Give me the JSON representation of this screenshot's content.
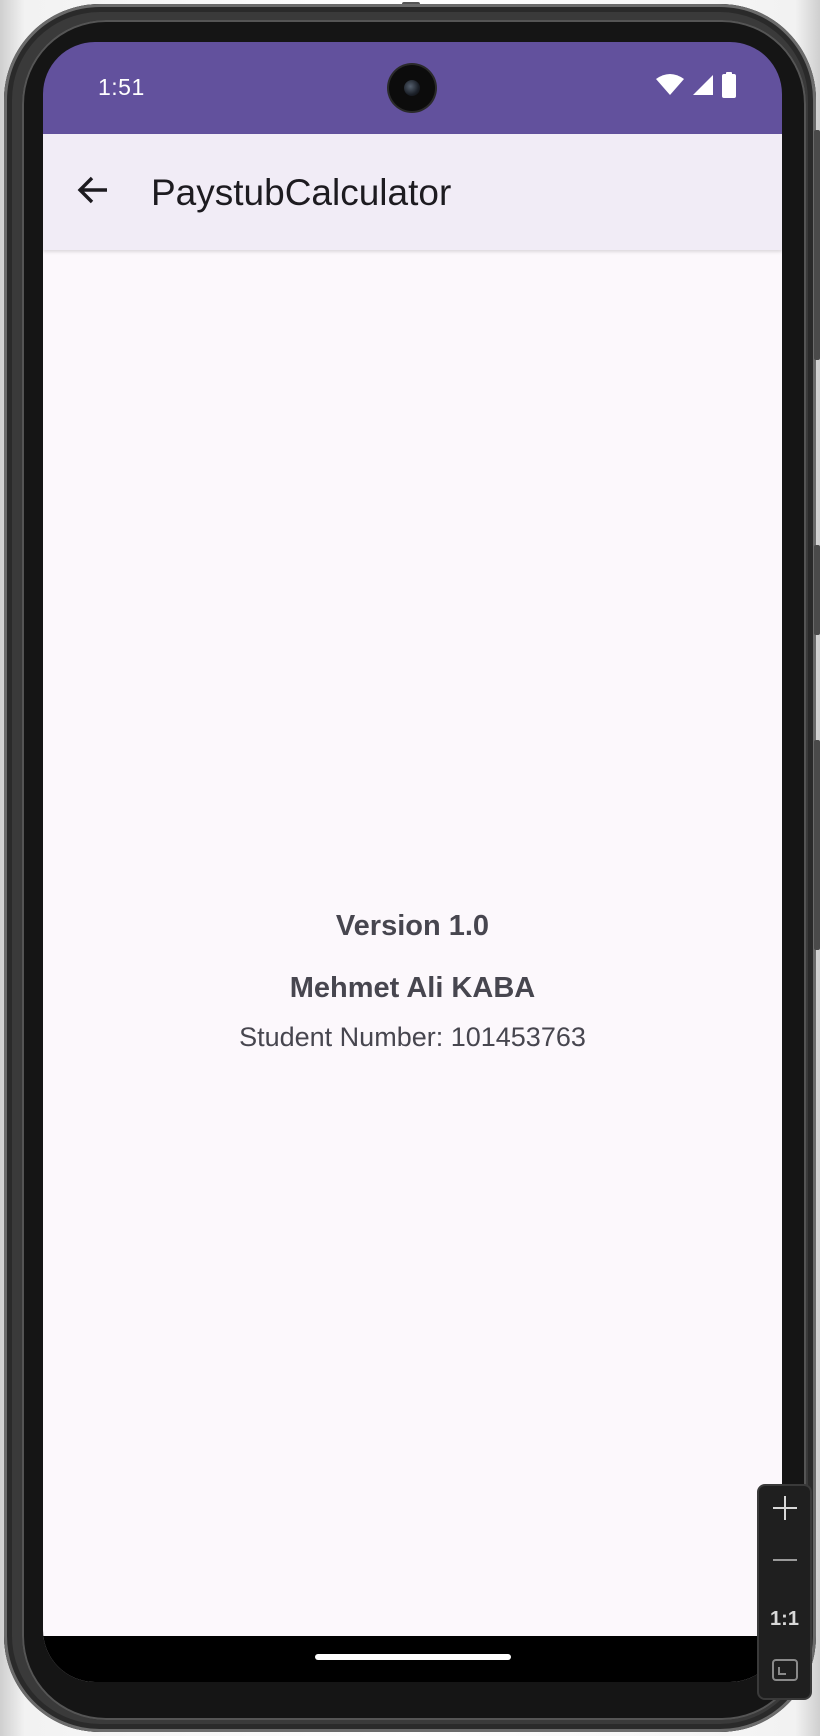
{
  "status_bar": {
    "time": "1:51",
    "color": "#62519d",
    "icons": [
      "wifi-icon",
      "cellular-signal-icon",
      "battery-icon"
    ]
  },
  "app_bar": {
    "title": "PaystubCalculator",
    "back_icon": "arrow-back-icon",
    "background": "#f1ecf6"
  },
  "about": {
    "version": "Version 1.0",
    "author": "Mehmet Ali KABA",
    "student_number": "Student Number: 101453763"
  },
  "emulator_toolbar": {
    "zoom_in_icon": "plus-icon",
    "zoom_out_icon": "minus-icon",
    "actual_size_label": "1:1",
    "fit_icon": "fit-screen-icon"
  },
  "colors": {
    "content_background": "#fcf8fc",
    "text_secondary": "#47464f",
    "title_text": "#1d1b20"
  }
}
